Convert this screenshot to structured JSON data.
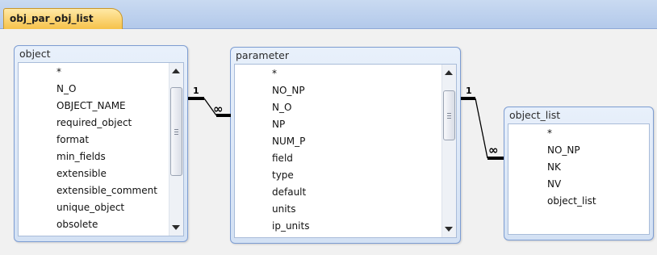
{
  "tab": {
    "label": "obj_par_obj_list"
  },
  "tables": {
    "object": {
      "title": "object",
      "fields": [
        "*",
        "N_O",
        "OBJECT_NAME",
        "required_object",
        "format",
        "min_fields",
        "extensible",
        "extensible_comment",
        "unique_object",
        "obsolete"
      ]
    },
    "parameter": {
      "title": "parameter",
      "fields": [
        "*",
        "NO_NP",
        "N_O",
        "NP",
        "NUM_P",
        "field",
        "type",
        "default",
        "units",
        "ip_units"
      ]
    },
    "object_list": {
      "title": "object_list",
      "fields": [
        "*",
        "NO_NP",
        "NK",
        "NV",
        "object_list"
      ]
    }
  },
  "relationships": [
    {
      "from": "object.N_O",
      "to": "parameter.N_O",
      "one_label": "1",
      "many_label": "∞"
    },
    {
      "from": "parameter.NO_NP",
      "to": "object_list.NO_NP",
      "one_label": "1",
      "many_label": "∞"
    }
  ]
}
